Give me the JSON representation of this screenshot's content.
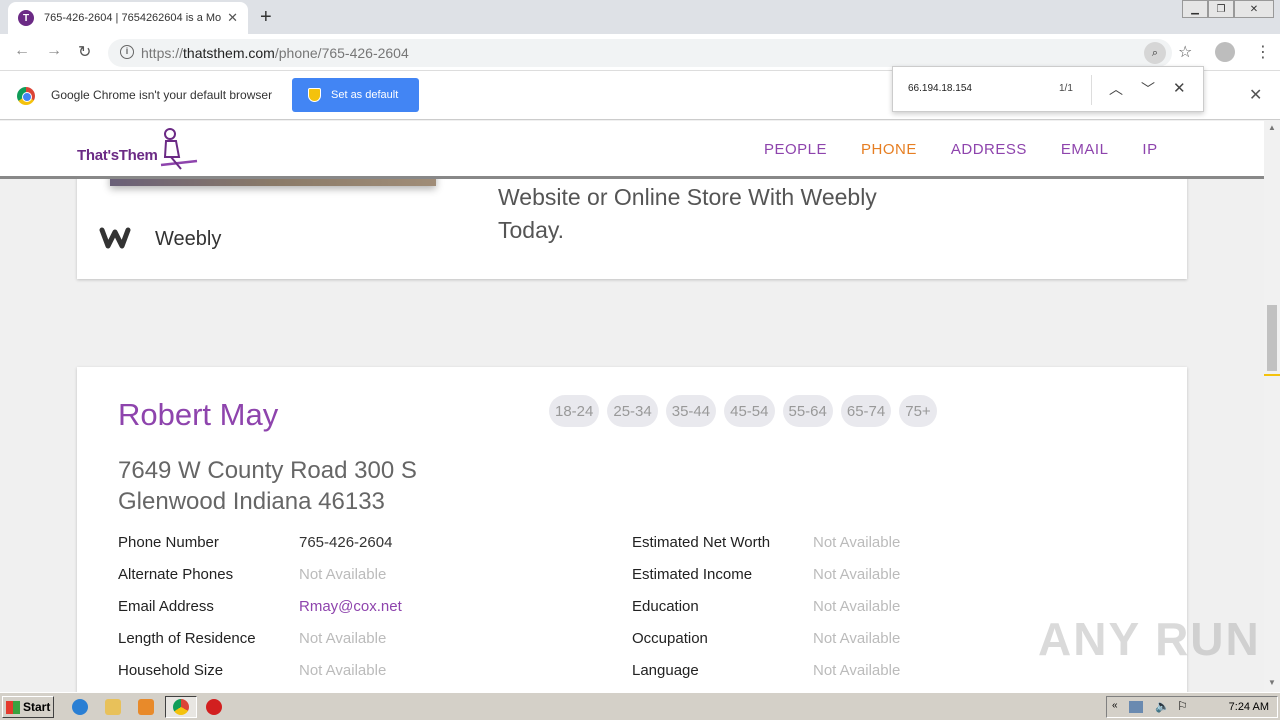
{
  "browser": {
    "tab_title": "765-426-2604 | 7654262604 is a Mo",
    "tab_favicon_letter": "T",
    "url_scheme": "https://",
    "url_host": "thatsthem.com",
    "url_path": "/phone/765-426-2604",
    "infobar_text": "Google Chrome isn't your default browser",
    "infobar_button": "Set as default",
    "find_query": "66.194.18.154",
    "find_count": "1/1"
  },
  "site": {
    "logo_text": "That'sThem",
    "nav": [
      "PEOPLE",
      "PHONE",
      "ADDRESS",
      "EMAIL",
      "IP"
    ],
    "active_nav": "PHONE",
    "accent_color": "#8e44ad",
    "active_color": "#e67e22"
  },
  "ad": {
    "brand": "Weebly",
    "text": "Website or Online Store With Weebly Today."
  },
  "person": {
    "name": "Robert May",
    "age_ranges": [
      "18-24",
      "25-34",
      "35-44",
      "45-54",
      "55-64",
      "65-74",
      "75+"
    ],
    "address_line1": "7649 W County Road 300 S",
    "address_line2": "Glenwood Indiana 46133",
    "left_details": [
      {
        "label": "Phone Number",
        "value": "765-426-2604"
      },
      {
        "label": "Alternate Phones",
        "value": "Not Available"
      },
      {
        "label": "Email Address",
        "value": "Rmay@cox.net"
      },
      {
        "label": "Length of Residence",
        "value": "Not Available"
      },
      {
        "label": "Household Size",
        "value": "Not Available"
      }
    ],
    "right_details": [
      {
        "label": "Estimated Net Worth",
        "value": "Not Available"
      },
      {
        "label": "Estimated Income",
        "value": "Not Available"
      },
      {
        "label": "Education",
        "value": "Not Available"
      },
      {
        "label": "Occupation",
        "value": "Not Available"
      },
      {
        "label": "Language",
        "value": "Not Available"
      }
    ]
  },
  "watermark": "ANY RUN",
  "taskbar": {
    "start_label": "Start",
    "clock": "7:24 AM"
  }
}
